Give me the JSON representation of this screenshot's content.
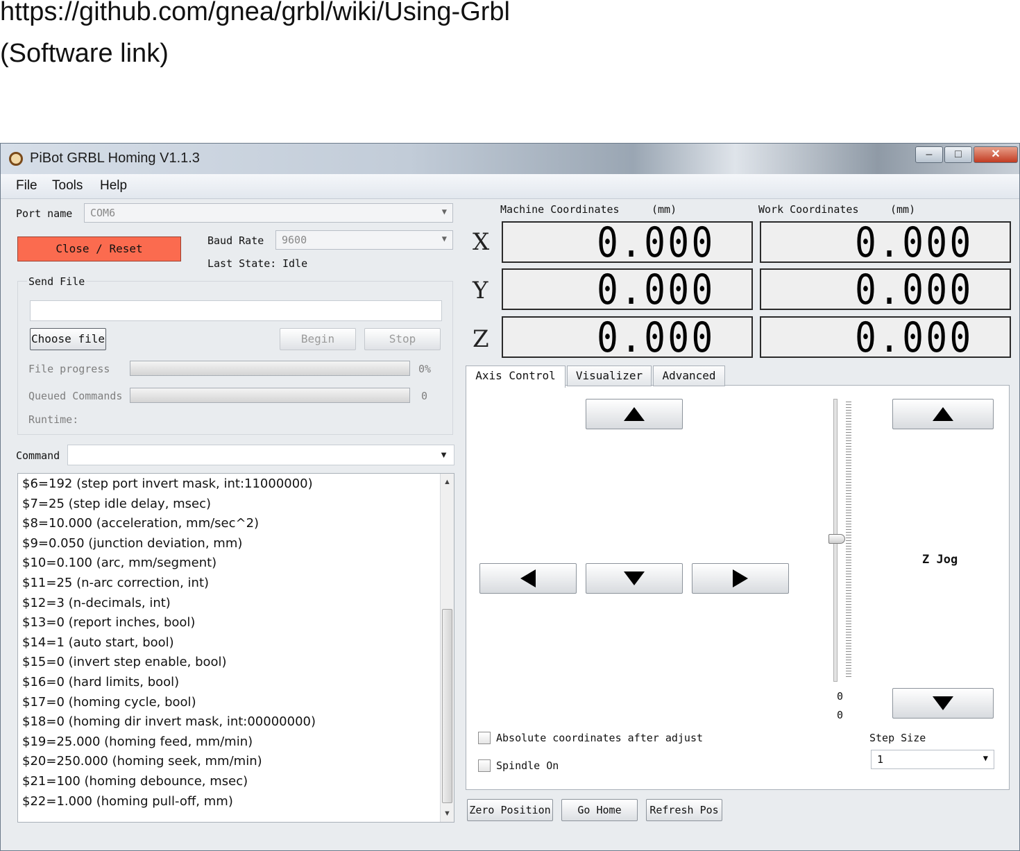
{
  "caption": {
    "line1": "https://github.com/gnea/grbl/wiki/Using-Grbl",
    "line2": "(Software link)"
  },
  "window": {
    "title": "PiBot GRBL Homing V1.1.3",
    "controls": {
      "minimize": "–",
      "maximize": "□",
      "close": "✕"
    }
  },
  "menu": [
    "File",
    "Tools",
    "Help"
  ],
  "connection": {
    "port_label": "Port name",
    "port_value": "COM6",
    "close_reset_label": "Close / Reset",
    "baud_label": "Baud Rate",
    "baud_value": "9600",
    "last_state_label": "Last State:",
    "last_state_value": "Idle"
  },
  "send_file": {
    "group_label": "Send File",
    "choose_label": "Choose file",
    "begin_label": "Begin",
    "stop_label": "Stop",
    "file_progress_label": "File progress",
    "file_progress_value": "0%",
    "file_progress_fraction": 0,
    "queued_label": "Queued Commands",
    "queued_value": "0",
    "runtime_label": "Runtime:"
  },
  "command": {
    "label": "Command",
    "value": ""
  },
  "log": [
    "$6=192 (step port invert mask, int:11000000)",
    "$7=25 (step idle delay, msec)",
    "$8=10.000 (acceleration, mm/sec^2)",
    "$9=0.050 (junction deviation, mm)",
    "$10=0.100 (arc, mm/segment)",
    "$11=25 (n-arc correction, int)",
    "$12=3 (n-decimals, int)",
    "$13=0 (report inches, bool)",
    "$14=1 (auto start, bool)",
    "$15=0 (invert step enable, bool)",
    "$16=0 (hard limits, bool)",
    "$17=0 (homing cycle, bool)",
    "$18=0 (homing dir invert mask, int:00000000)",
    "$19=25.000 (homing feed, mm/min)",
    "$20=250.000 (homing seek, mm/min)",
    "$21=100 (homing debounce, msec)",
    "$22=1.000 (homing pull-off, mm)"
  ],
  "coordinates": {
    "machine_label": "Machine Coordinates",
    "work_label": "Work Coordinates",
    "unit": "(mm)",
    "axes": [
      {
        "axis": "X",
        "machine": "0.000",
        "work": "0.000"
      },
      {
        "axis": "Y",
        "machine": "0.000",
        "work": "0.000"
      },
      {
        "axis": "Z",
        "machine": "0.000",
        "work": "0.000"
      }
    ]
  },
  "tabs": [
    {
      "label": "Axis Control",
      "active": true
    },
    {
      "label": "Visualizer",
      "active": false
    },
    {
      "label": "Advanced",
      "active": false
    }
  ],
  "axis_control": {
    "z_jog_label": "Z Jog",
    "slider_value_1": "0",
    "slider_value_2": "0",
    "absolute_label": "Absolute coordinates after adjust",
    "absolute_checked": false,
    "spindle_label": "Spindle On",
    "spindle_checked": false,
    "step_size_label": "Step Size",
    "step_size_value": "1"
  },
  "bottom_buttons": {
    "zero": "Zero Position",
    "home": "Go Home",
    "refresh": "Refresh Pos"
  },
  "colors": {
    "close_reset_bg": "#fb6b4f",
    "window_bg": "#e9ecef"
  }
}
